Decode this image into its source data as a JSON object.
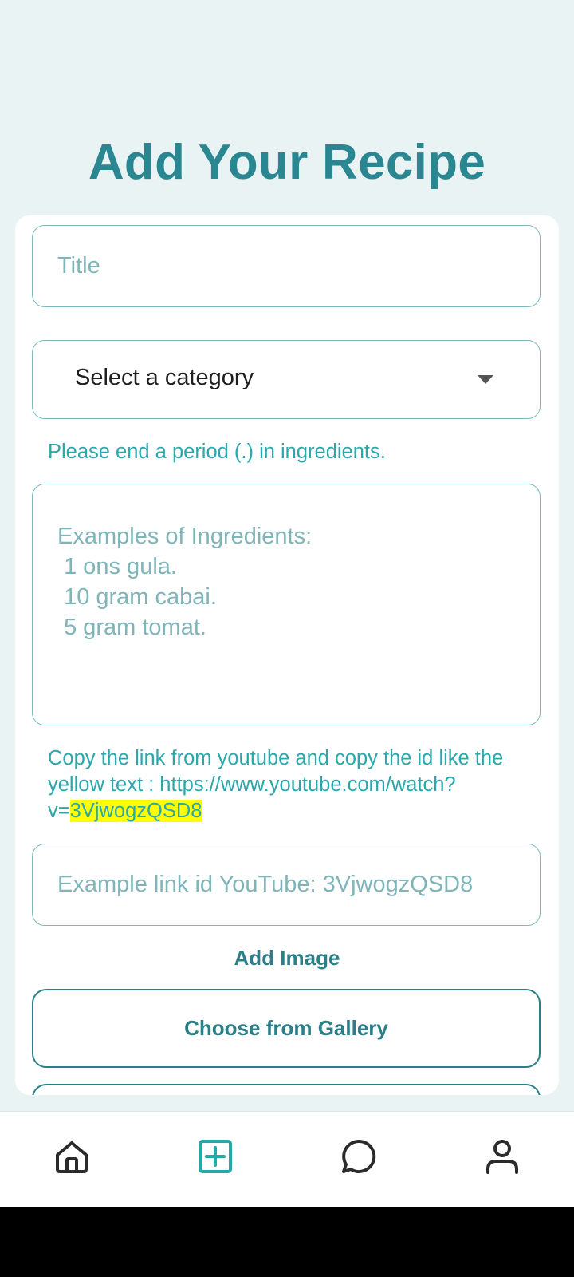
{
  "page": {
    "title": "Add Your Recipe"
  },
  "form": {
    "title_placeholder": "Title",
    "title_value": "",
    "category_selected": "Select a category",
    "period_hint": "Please end a period (.) in ingredients.",
    "ingredients_placeholder": "Examples of Ingredients:\n 1 ons gula.\n 10 gram cabai.\n 5 gram tomat.",
    "youtube_hint_text": "Copy the link from youtube and copy the id like the yellow text : https://www.youtube.com/watch?v=",
    "youtube_hint_id": "3VjwogzQSD8",
    "youtube_placeholder": "Example link id YouTube: 3VjwogzQSD8",
    "add_image_label": "Add Image",
    "gallery_button": "Choose from Gallery"
  },
  "bottom_nav": {
    "items": [
      {
        "icon": "home-icon",
        "active": false
      },
      {
        "icon": "add-recipe-icon",
        "active": true
      },
      {
        "icon": "chat-icon",
        "active": false
      },
      {
        "icon": "profile-icon",
        "active": false
      }
    ]
  },
  "colors": {
    "background": "#e9f3f4",
    "accent": "#2a8791",
    "hint_text": "#2aa8ac",
    "highlight": "#ffff00",
    "nav_active": "#27a8a8",
    "nav_inactive": "#2b2b2b"
  }
}
